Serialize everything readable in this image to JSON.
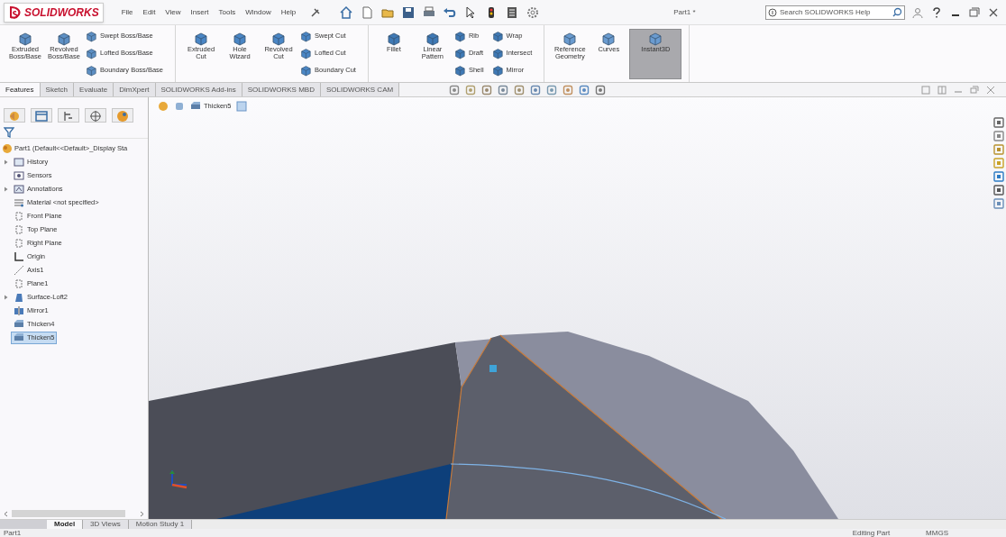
{
  "title_bar": {
    "logo": "SOLIDWORKS",
    "menu": [
      "File",
      "Edit",
      "View",
      "Insert",
      "Tools",
      "Window",
      "Help"
    ],
    "document_title": "Part1 *",
    "search": {
      "placeholder": "Search SOLIDWORKS Help"
    }
  },
  "ribbon": {
    "groups": [
      {
        "items": [
          {
            "label": "Extruded Boss/Base",
            "kind": "large",
            "selected": false
          },
          {
            "label": "Revolved Boss/Base",
            "kind": "large",
            "selected": false
          },
          {
            "label": "Swept Boss/Base",
            "kind": "small",
            "selected": false
          },
          {
            "label": "Lofted Boss/Base",
            "kind": "small",
            "selected": false
          },
          {
            "label": "Boundary Boss/Base",
            "kind": "small",
            "selected": false
          }
        ]
      },
      {
        "items": [
          {
            "label": "Extruded Cut",
            "kind": "large",
            "selected": false
          },
          {
            "label": "Hole Wizard",
            "kind": "large",
            "selected": false
          },
          {
            "label": "Revolved Cut",
            "kind": "large",
            "selected": false
          },
          {
            "label": "Swept Cut",
            "kind": "small",
            "selected": false
          },
          {
            "label": "Lofted Cut",
            "kind": "small",
            "selected": false
          },
          {
            "label": "Boundary Cut",
            "kind": "small",
            "selected": false
          }
        ]
      },
      {
        "items": [
          {
            "label": "Fillet",
            "kind": "large",
            "selected": false
          },
          {
            "label": "Linear Pattern",
            "kind": "large",
            "selected": false
          },
          {
            "label": "Rib",
            "kind": "small",
            "selected": false
          },
          {
            "label": "Draft",
            "kind": "small",
            "selected": false
          },
          {
            "label": "Shell",
            "kind": "small",
            "selected": false
          },
          {
            "label": "Wrap",
            "kind": "small",
            "selected": false
          },
          {
            "label": "Intersect",
            "kind": "small",
            "selected": false
          },
          {
            "label": "Mirror",
            "kind": "small",
            "selected": false
          }
        ]
      },
      {
        "items": [
          {
            "label": "Reference Geometry",
            "kind": "large",
            "selected": false
          },
          {
            "label": "Curves",
            "kind": "large",
            "selected": false
          },
          {
            "label": "Instant3D",
            "kind": "large",
            "selected": true
          }
        ]
      }
    ]
  },
  "tabs": [
    {
      "label": "Features",
      "selected": true
    },
    {
      "label": "Sketch",
      "selected": false
    },
    {
      "label": "Evaluate",
      "selected": false
    },
    {
      "label": "DimXpert",
      "selected": false
    },
    {
      "label": "SOLIDWORKS Add-ins",
      "selected": false
    },
    {
      "label": "SOLIDWORKS MBD",
      "selected": false
    },
    {
      "label": "SOLIDWORKS CAM",
      "selected": false
    }
  ],
  "feature_tree": {
    "root": "Part1  (Default<<Default>_Display Sta",
    "items": [
      {
        "label": "History",
        "expandable": true,
        "selected": false
      },
      {
        "label": "Sensors",
        "expandable": false,
        "selected": false
      },
      {
        "label": "Annotations",
        "expandable": true,
        "selected": false
      },
      {
        "label": "Material <not specified>",
        "expandable": false,
        "selected": false
      },
      {
        "label": "Front Plane",
        "expandable": false,
        "selected": false
      },
      {
        "label": "Top Plane",
        "expandable": false,
        "selected": false
      },
      {
        "label": "Right Plane",
        "expandable": false,
        "selected": false
      },
      {
        "label": "Origin",
        "expandable": false,
        "selected": false
      },
      {
        "label": "Axis1",
        "expandable": false,
        "selected": false
      },
      {
        "label": "Plane1",
        "expandable": false,
        "selected": false
      },
      {
        "label": "Surface-Loft2",
        "expandable": true,
        "selected": false
      },
      {
        "label": "Mirror1",
        "expandable": false,
        "selected": false
      },
      {
        "label": "Thicken4",
        "expandable": false,
        "selected": false
      },
      {
        "label": "Thicken5",
        "expandable": false,
        "selected": true
      }
    ]
  },
  "breadcrumb": {
    "label": "Thicken5"
  },
  "bottom_tabs": [
    {
      "label": "Model",
      "selected": true
    },
    {
      "label": "3D Views",
      "selected": false
    },
    {
      "label": "Motion Study 1",
      "selected": false
    }
  ],
  "status_bar": {
    "left": "Part1",
    "mode": "Editing Part",
    "units": "MMGS"
  }
}
